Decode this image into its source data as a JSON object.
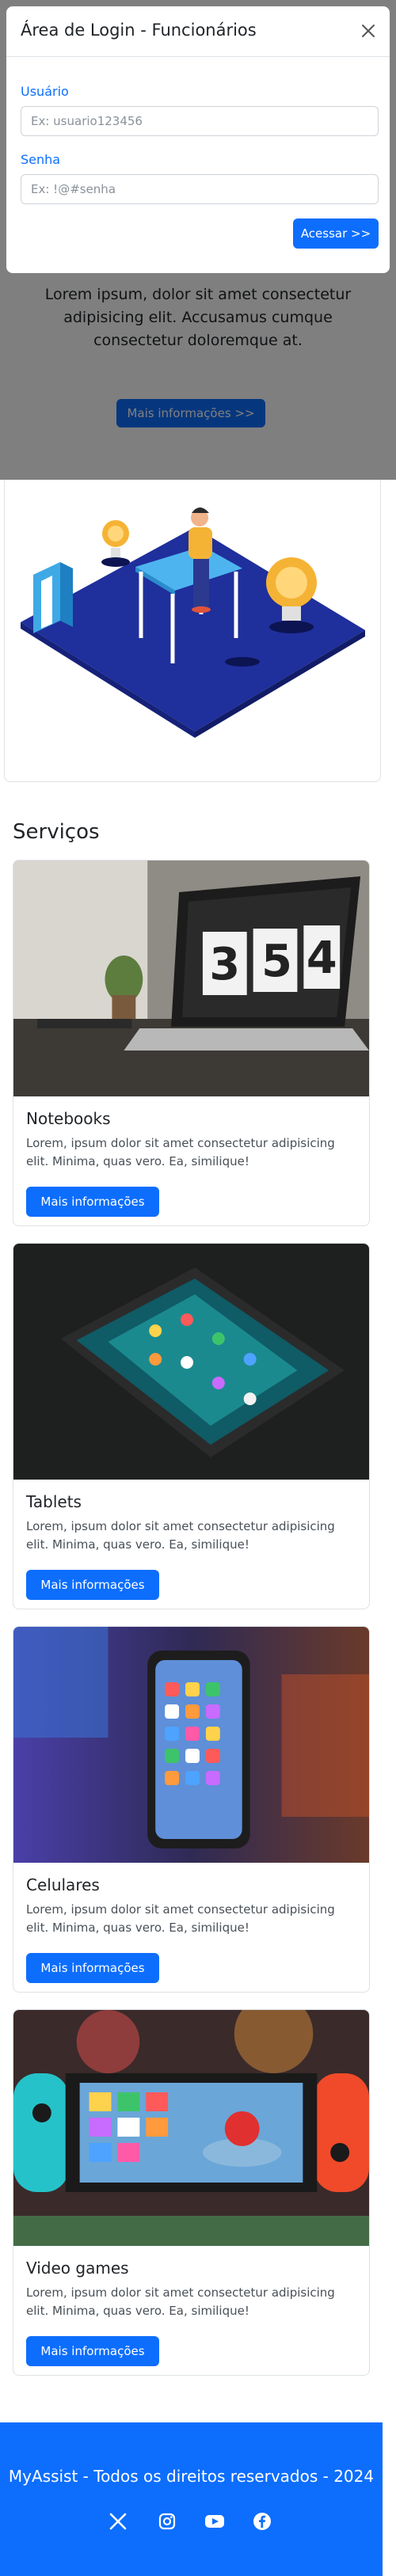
{
  "modal": {
    "title": "Área de Login - Funcionários",
    "user_label": "Usuário",
    "user_placeholder": "Ex: usuario123456",
    "password_label": "Senha",
    "password_placeholder": "Ex: !@#senha",
    "submit_label": "Acessar >>"
  },
  "hero": {
    "text": "Lorem ipsum, dolor sit amet consectetur adipisicing elit. Accusamus cumque consectetur doloremque at.",
    "button_label": "Mais informações >>"
  },
  "services": {
    "title": "Serviços",
    "items": [
      {
        "title": "Notebooks",
        "text": "Lorem, ipsum dolor sit amet consectetur adipisicing elit. Minima, quas vero. Ea, similique!",
        "button_label": "Mais informações"
      },
      {
        "title": "Tablets",
        "text": "Lorem, ipsum dolor sit amet consectetur adipisicing elit. Minima, quas vero. Ea, similique!",
        "button_label": "Mais informações"
      },
      {
        "title": "Celulares",
        "text": "Lorem, ipsum dolor sit amet consectetur adipisicing elit. Minima, quas vero. Ea, similique!",
        "button_label": "Mais informações"
      },
      {
        "title": "Video games",
        "text": "Lorem, ipsum dolor sit amet consectetur adipisicing elit. Minima, quas vero. Ea, similique!",
        "button_label": "Mais informações"
      }
    ]
  },
  "footer": {
    "text": "MyAssist - Todos os direitos reservados - 2024",
    "social": [
      "x-icon",
      "instagram-icon",
      "youtube-icon",
      "facebook-icon"
    ]
  },
  "colors": {
    "primary": "#0d6efd",
    "backdrop": "rgba(0,0,0,0.5)"
  }
}
